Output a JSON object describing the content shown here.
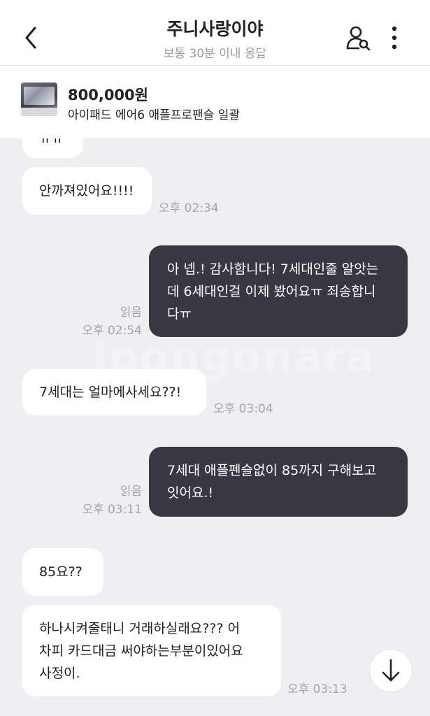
{
  "header": {
    "title": "주니사랑이야",
    "subtitle": "보통 30분 이내 응답"
  },
  "product": {
    "price": "800,000원",
    "title": "아이패드 에어6 애플프로팬슬 일괄"
  },
  "watermark": "Joongonara",
  "messages": [
    {
      "text": "ㅠㅠ"
    },
    {
      "text": "안까져있어요!!!!",
      "time": "오후 02:34"
    },
    {
      "lines": [
        "아 넵.! 감사함니다! 7세대인줄 알앗는",
        "데 6세대인걸 이제 봤어요ㅠ 죄송합니",
        "다ㅠ"
      ],
      "status": "읽음",
      "time": "오후 02:54"
    },
    {
      "text": "7세대는 얼마에사세요??!",
      "time": "오후 03:04"
    },
    {
      "lines": [
        "7세대 애플펜슬없이 85까지 구해보고",
        "잇어요.!"
      ],
      "status": "읽음",
      "time": "오후 03:11"
    },
    {
      "text": "85요??"
    },
    {
      "lines": [
        "하나시켜줄태니 거래하실래요??? 어",
        "차피 카드대금 써야하는부분이있어요",
        "사정이."
      ],
      "time": "오후 03:13"
    }
  ],
  "icons": {
    "back": "chevron-left-icon",
    "profile": "user-search-icon",
    "more": "more-vertical-icon",
    "scroll": "arrow-down-icon"
  },
  "colors": {
    "outgoing_bubble": "#363941",
    "incoming_bubble": "#ffffff",
    "background": "#eeeff1"
  }
}
